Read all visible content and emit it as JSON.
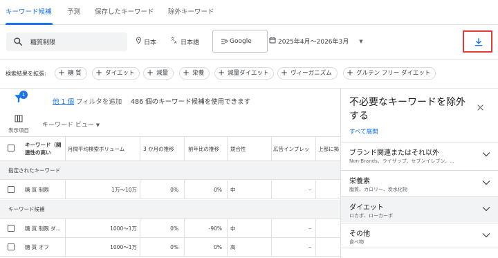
{
  "tabs": [
    {
      "label": "キーワード候補",
      "active": true
    },
    {
      "label": "予測",
      "active": false
    },
    {
      "label": "保存したキーワード",
      "active": false
    },
    {
      "label": "除外キーワード",
      "active": false
    }
  ],
  "search": {
    "value": "糖質制限",
    "icon": "search-icon"
  },
  "location": {
    "label": "日本",
    "icon": "location-pin-icon"
  },
  "language": {
    "label": "日本語",
    "icon": "translate-icon"
  },
  "engine": {
    "label": "Google",
    "icon": "search-engine-icon"
  },
  "daterange": {
    "label": "2025年4月～2026年3月",
    "icon": "calendar-icon"
  },
  "download": {
    "icon": "download-icon",
    "highlight_color": "#e53935"
  },
  "expand": {
    "label": "検索結果を拡張:",
    "chips": [
      "糖 質",
      "ダイエット",
      "減量",
      "栄養",
      "減量ダイエット",
      "ヴィーガニズム",
      "グルテン フリー ダイエット"
    ]
  },
  "summary": {
    "filter_badge": "1",
    "excluded_link": "他 1 個",
    "add_filter": "フィルタを追加",
    "count_text": "486 個のキーワード候補を使用できます"
  },
  "view": {
    "columns_label": "表示項目",
    "keyword_view": "キーワード ビュー"
  },
  "table": {
    "headers": [
      "キーワード（関連性の高い",
      "月間平均検索ボリューム",
      "3 か月の推移",
      "前年比の推移",
      "競合性",
      "広告インプレッ",
      "上部に掲"
    ],
    "sections": [
      {
        "title": "指定されたキーワード",
        "rows": [
          {
            "keyword": "糖 質 制限",
            "volume": "1万～10万",
            "three_month": "0%",
            "yoy": "0%",
            "competition": "中",
            "impression": "–"
          }
        ]
      },
      {
        "title": "キーワード候補",
        "rows": [
          {
            "keyword": "糖 質 制限 ダ...",
            "volume": "1000～1万",
            "three_month": "0%",
            "yoy": "-90%",
            "competition": "中",
            "impression": "–"
          },
          {
            "keyword": "糖 質 オフ",
            "volume": "1000～1万",
            "three_month": "0%",
            "yoy": "0%",
            "competition": "高",
            "impression": "–"
          }
        ]
      }
    ]
  },
  "panel": {
    "title": "不必要なキーワードを除外する",
    "expand_all": "すべて展開",
    "groups": [
      {
        "title": "ブランド関連またはそれ以外",
        "subtitle": "Non-Brands、ライザップ、セブンイレブン、..."
      },
      {
        "title": "栄養素",
        "subtitle": "脂質、カロリー、炭水化物"
      },
      {
        "title": "ダイエット",
        "subtitle": "ロカボ、ローカーボ"
      },
      {
        "title": "その他",
        "subtitle": "食べ物"
      }
    ]
  },
  "colors": {
    "accent": "#1a73e8",
    "text": "#202124",
    "muted": "#5f6368"
  }
}
